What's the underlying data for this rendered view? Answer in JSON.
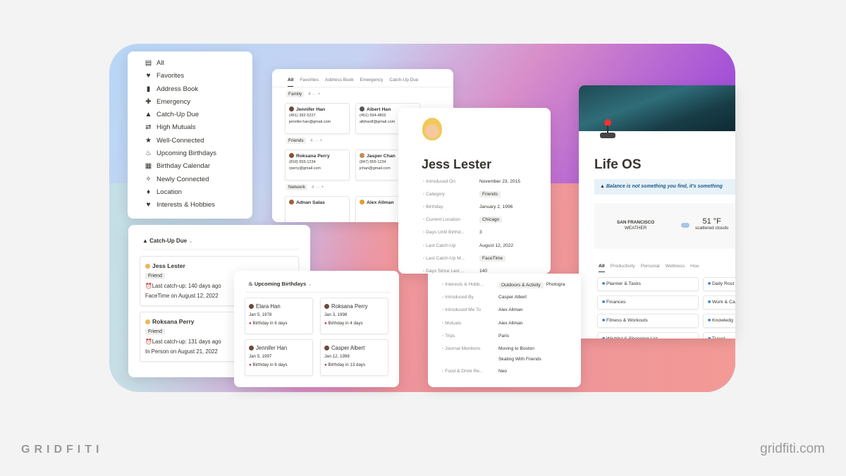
{
  "menu": {
    "items": [
      {
        "label": "All",
        "icon": "contact-card-icon",
        "g": "▤"
      },
      {
        "label": "Favorites",
        "icon": "heart-icon",
        "g": "♥"
      },
      {
        "label": "Address Book",
        "icon": "book-icon",
        "g": "▮"
      },
      {
        "label": "Emergency",
        "icon": "plus-icon",
        "g": "✚"
      },
      {
        "label": "Catch-Up Due",
        "icon": "warning-icon",
        "g": "▲"
      },
      {
        "label": "High Mutuals",
        "icon": "arrows-icon",
        "g": "⇄"
      },
      {
        "label": "Well-Connected",
        "icon": "star-icon",
        "g": "★"
      },
      {
        "label": "Upcoming Birthdays",
        "icon": "cake-icon",
        "g": "♨"
      },
      {
        "label": "Birthday Calendar",
        "icon": "calendar-icon",
        "g": "▦"
      },
      {
        "label": "Newly Connected",
        "icon": "sparkle-icon",
        "g": "✧"
      },
      {
        "label": "Location",
        "icon": "pin-icon",
        "g": "♦"
      },
      {
        "label": "Interests & Hobbies",
        "icon": "heart-icon",
        "g": "♥"
      }
    ]
  },
  "address_book": {
    "tabs": [
      "All",
      "Favorites",
      "Address Book",
      "Emergency",
      "Catch-Up Due"
    ],
    "groups": [
      {
        "name": "Family",
        "count": "4",
        "people": [
          {
            "name": "Jennifer Han",
            "phone": "(451) 392-5227",
            "email": "jennifer.han@gmail.com",
            "color": "#6b4a3a"
          },
          {
            "name": "Albert Han",
            "phone": "(451) 594-4802",
            "email": "albhan8@gmail.com",
            "color": "#555"
          }
        ]
      },
      {
        "name": "Friends",
        "count": "4",
        "people": [
          {
            "name": "Roksana Perry",
            "phone": "(818) 555-1234",
            "email": "rperry@gmail.com",
            "color": "#8a5030"
          },
          {
            "name": "Jasper Chan",
            "phone": "(847) 555-1234",
            "email": "jchan@gmail.com",
            "color": "#c88a50"
          }
        ]
      },
      {
        "name": "Network",
        "count": "4",
        "people": [
          {
            "name": "Adnan Salas",
            "color": "#a0603a"
          },
          {
            "name": "Alex Allman",
            "color": "#e0a030"
          }
        ]
      }
    ]
  },
  "profile": {
    "name": "Jess Lester",
    "props": [
      {
        "k": "Introduced On",
        "v": "November 23, 2015"
      },
      {
        "k": "Category",
        "v": "Friends",
        "tag": true
      },
      {
        "k": "Birthday",
        "v": "January 2, 1996"
      },
      {
        "k": "Current Location",
        "v": "Chicago",
        "tag": true
      },
      {
        "k": "Days Until Birthd...",
        "v": "3"
      },
      {
        "k": "Last Catch-Up",
        "v": "August 12, 2022"
      },
      {
        "k": "Last Catch-Up M...",
        "v": "FaceTime",
        "tag": true
      },
      {
        "k": "Days Since Last ...",
        "v": "140"
      }
    ],
    "props2": [
      {
        "k": "Interests & Hobb...",
        "v": "Outdoors & Activity",
        "v2": "Photogra"
      },
      {
        "k": "Introduced By",
        "v": "Casper Albert"
      },
      {
        "k": "Introduced Me To",
        "v": "Alex Allman"
      },
      {
        "k": "Mutuals",
        "v": "Alex Allman"
      },
      {
        "k": "Trips",
        "v": "Paris"
      },
      {
        "k": "Journal Mentions",
        "v": "Moving to Boston",
        "v2": "Skating With Friends"
      },
      {
        "k": "Food & Drink Re...",
        "v": "Neo"
      }
    ]
  },
  "catchup": {
    "title": "Catch-Up Due",
    "cards": [
      {
        "name": "Jess Lester",
        "tag": "Friend",
        "last": "Last catch-up: 140 days ago",
        "via": "FaceTime on August 12, 2022"
      },
      {
        "name": "Roksana Perry",
        "tag": "Friend",
        "last": "Last catch-up: 131 days ago",
        "via": "In Person on August 21, 2022"
      }
    ]
  },
  "birthdays": {
    "title": "Upcoming Birthdays",
    "cards": [
      {
        "name": "Elara Han",
        "date": "Jan 5, 1978",
        "in": "Birthday in 6 days"
      },
      {
        "name": "Roksana Perry",
        "date": "Jan 3, 1998",
        "in": "Birthday in 4 days"
      },
      {
        "name": "Jennifer Han",
        "date": "Jan 5, 1997",
        "in": "Birthday in 6 days"
      },
      {
        "name": "Casper Albert",
        "date": "Jan 12, 1998",
        "in": "Birthday in 13 days"
      }
    ]
  },
  "lifeos": {
    "title": "Life OS",
    "quote": "Balance is not something you find, it's something",
    "city": "SAN FRANCISCO",
    "weather_label": "WEATHER",
    "temp": "51 °F",
    "conditions": "scattered clouds",
    "tabs": [
      "All",
      "Productivity",
      "Personal",
      "Wellness",
      "Hou"
    ],
    "tiles": [
      "Planner & Tasks",
      "Daily Rout",
      "Finances",
      "Work & Ca",
      "Fitness & Workouts",
      "Knowledg",
      "Wishlist & Shopping List",
      "Travel"
    ]
  },
  "footer": {
    "brand": "GRIDFITI",
    "url": "gridfiti.com"
  }
}
